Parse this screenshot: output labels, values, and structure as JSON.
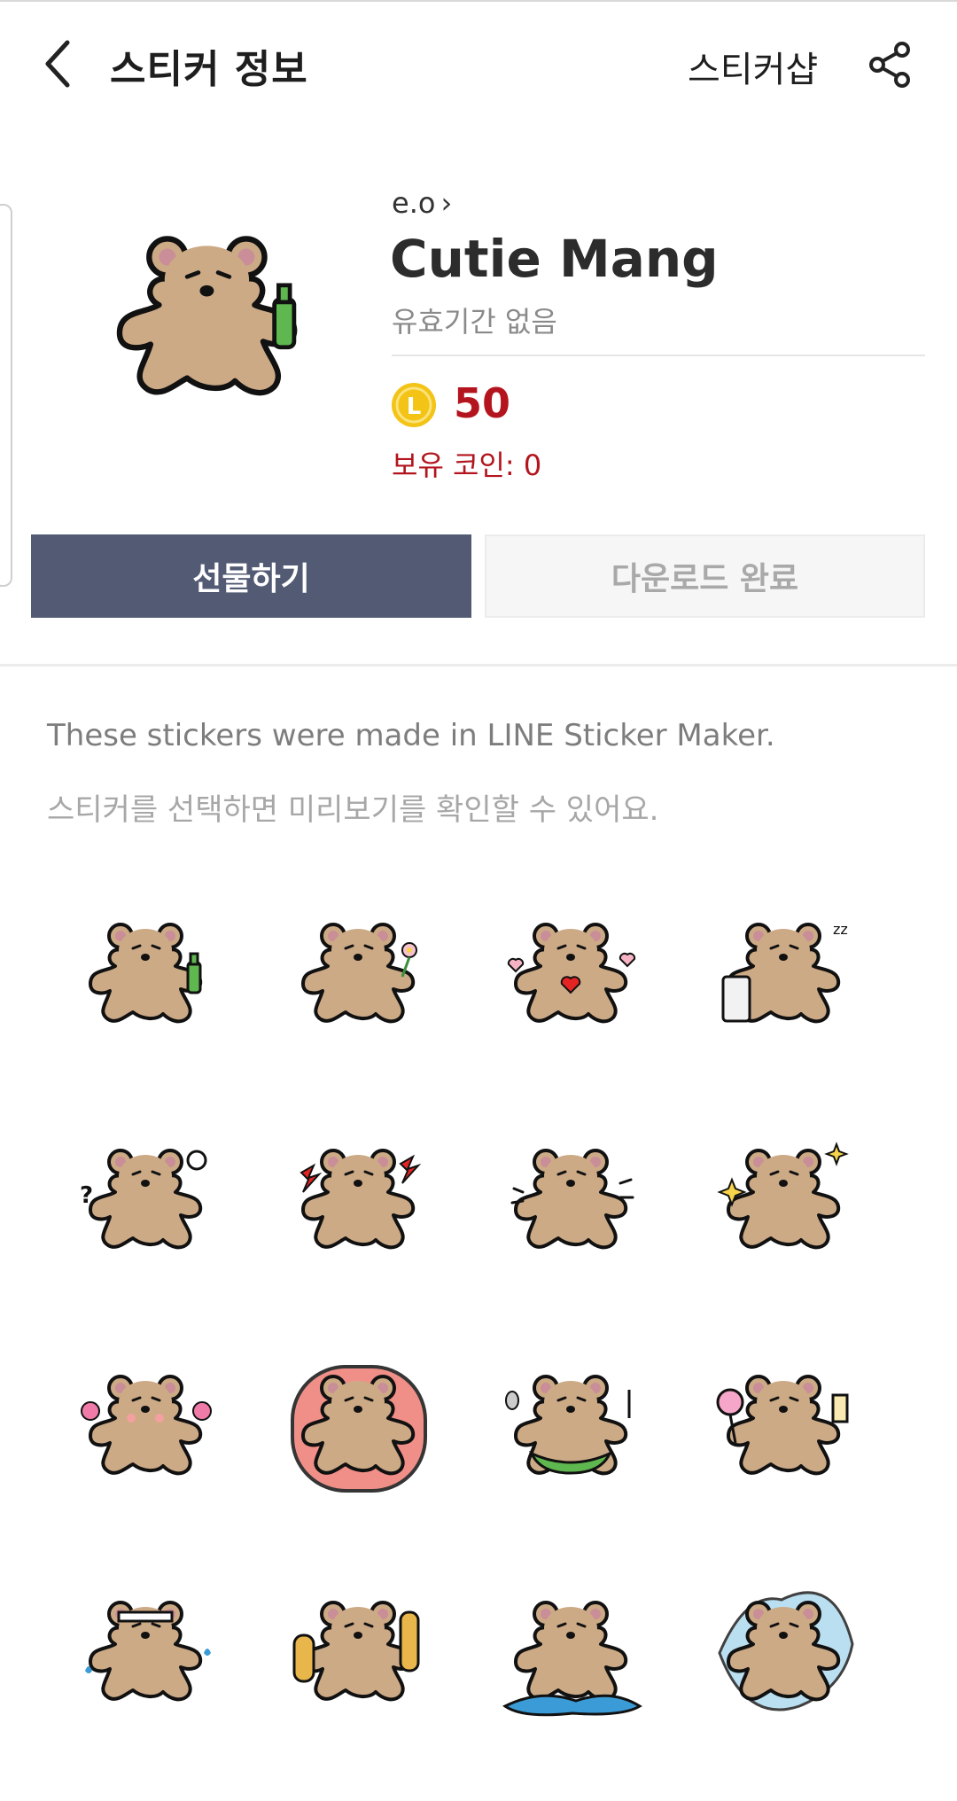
{
  "header": {
    "title": "스티커 정보",
    "shop_label": "스티커샵"
  },
  "product": {
    "author": "e.o",
    "name": "Cutie Mang",
    "validity": "유효기간 없음",
    "coin_symbol": "L",
    "price": "50",
    "owned_coins": "보유 코인: 0"
  },
  "buttons": {
    "gift": "선물하기",
    "download": "다운로드 완료"
  },
  "description": {
    "line1": "These stickers were made in LINE Sticker Maker.",
    "line2": "스티커를 선택하면 미리보기를 확인할 수 있어요."
  },
  "colors": {
    "bear": "#cdaa86",
    "ear_inner": "#c98e97",
    "gift_button": "#525b73",
    "price_red": "#b3141d",
    "coin_gold": "#f3c316"
  },
  "stickers": [
    {
      "accessory": "soju-bottle"
    },
    {
      "accessory": "flower"
    },
    {
      "accessory": "hearts"
    },
    {
      "accessory": "sleeping-pillow"
    },
    {
      "accessory": "question-bulb"
    },
    {
      "accessory": "lightning"
    },
    {
      "accessory": "surprised-lines"
    },
    {
      "accessory": "sparkles"
    },
    {
      "accessory": "pink-flowers"
    },
    {
      "accessory": "pink-blanket"
    },
    {
      "accessory": "spoon-fork-bib"
    },
    {
      "accessory": "lollipop-drink"
    },
    {
      "accessory": "headband-sweat"
    },
    {
      "accessory": "bread"
    },
    {
      "accessory": "puddle"
    },
    {
      "accessory": "blue-splash"
    }
  ]
}
